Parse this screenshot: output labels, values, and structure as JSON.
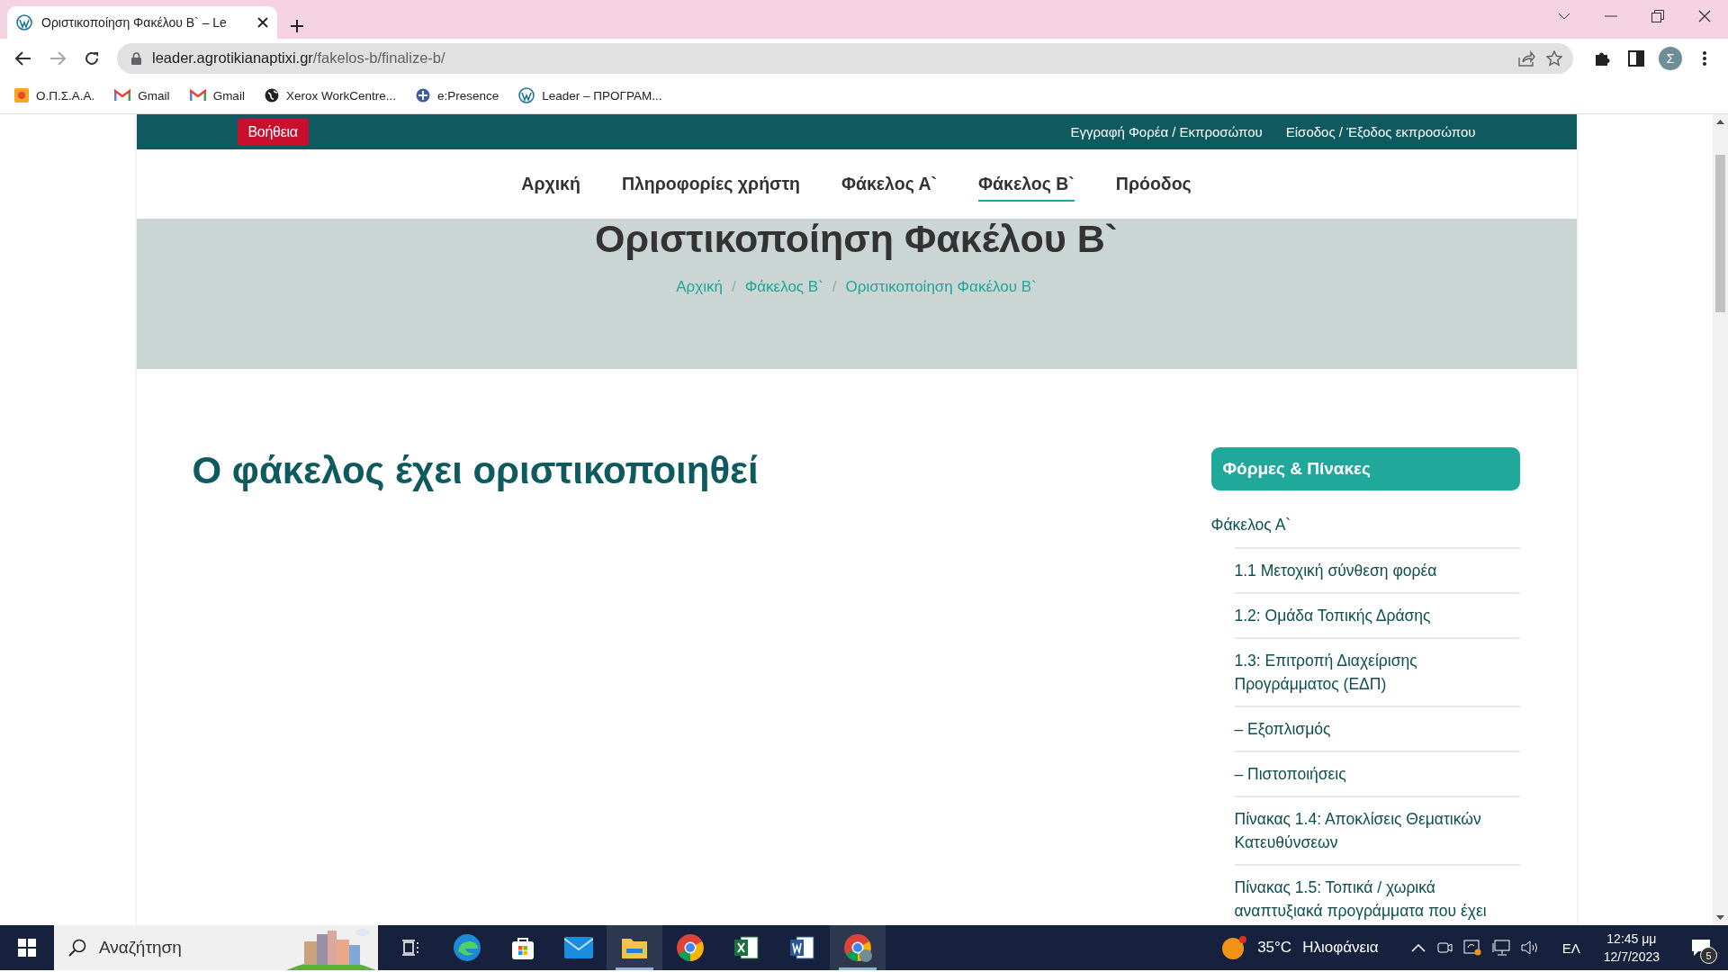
{
  "browser": {
    "tab_title": "Οριστικοποίηση Φακέλου Β` – Le",
    "url_host": "leader.agrotikianaptixi.gr",
    "url_path": "/fakelos-b/finalize-b/",
    "profile_initial": "Σ",
    "bookmarks": [
      {
        "label": "Ο.Π.Σ.Α.Α.",
        "kind": "sun"
      },
      {
        "label": "Gmail",
        "kind": "gmail"
      },
      {
        "label": "Gmail",
        "kind": "gmail"
      },
      {
        "label": "Xerox WorkCentre...",
        "kind": "globe"
      },
      {
        "label": "e:Presence",
        "kind": "cross"
      },
      {
        "label": "Leader – ΠΡΟΓΡΑΜ...",
        "kind": "wp"
      }
    ]
  },
  "site": {
    "help_button": "Βοήθεια",
    "top_links": [
      "Εγγραφή Φορέα / Εκπροσώπου",
      "Είσοδος / Έξοδος εκπροσώπου"
    ],
    "nav": [
      {
        "label": "Αρχική",
        "selected": false
      },
      {
        "label": "Πληροφορίες χρήστη",
        "selected": false
      },
      {
        "label": "Φάκελος Α`",
        "selected": false
      },
      {
        "label": "Φάκελος Β`",
        "selected": true
      },
      {
        "label": "Πρόοδος",
        "selected": false
      }
    ],
    "hero_title": "Οριστικοποίηση Φακέλου Β`",
    "breadcrumb": [
      "Αρχική",
      "Φάκελος Β`",
      "Οριστικοποίηση Φακέλου Β`"
    ],
    "breadcrumb_separator": "/",
    "heading": "Ο φάκελος έχει οριστικοποιηθεί",
    "sidebar": {
      "title": "Φόρμες & Πίνακες",
      "items": [
        {
          "label": "Φάκελος Α`",
          "children": [
            {
              "label": "1.1 Μετοχική σύνθεση φορέα"
            },
            {
              "label": "1.2: Ομάδα Τοπικής Δράσης"
            },
            {
              "label": "1.3: Επιτροπή Διαχείρισης Προγράμματος (ΕΔΠ)"
            },
            {
              "label": "– Εξοπλισμός"
            },
            {
              "label": "– Πιστοποιήσεις"
            },
            {
              "label": "Πίνακας 1.4: Αποκλίσεις Θεματικών Κατευθύνσεων"
            },
            {
              "label": "Πίνακας 1.5: Τοπικά / χωρικά αναπτυξιακά προγράμματα που έχει"
            }
          ]
        }
      ]
    }
  },
  "taskbar": {
    "search_placeholder": "Αναζήτηση",
    "apps": [
      {
        "kind": "taskview",
        "running": false
      },
      {
        "kind": "edge",
        "running": false
      },
      {
        "kind": "store",
        "running": false
      },
      {
        "kind": "mail",
        "running": false
      },
      {
        "kind": "folder",
        "running": true
      },
      {
        "kind": "chrome",
        "running": false
      },
      {
        "kind": "excel",
        "running": false
      },
      {
        "kind": "word",
        "running": false
      },
      {
        "kind": "chrome-profile",
        "running": true
      }
    ],
    "temperature": "35°C",
    "weather": "Ηλιοφάνεια",
    "language": "ΕΛ",
    "time": "12:45 μμ",
    "date": "12/7/2023",
    "notifications": "5"
  }
}
